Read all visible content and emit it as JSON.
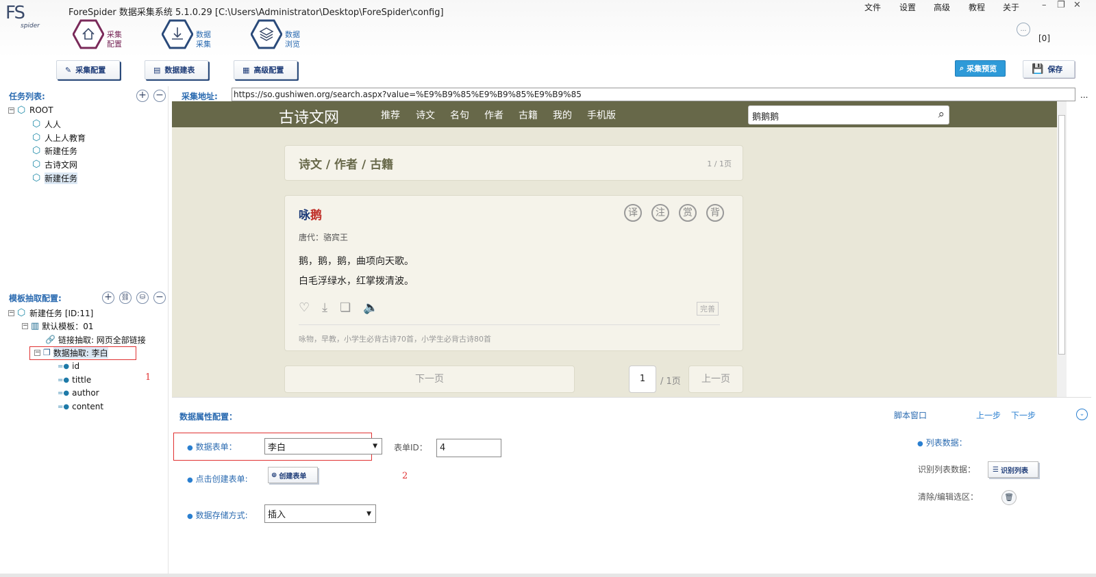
{
  "app": {
    "logo_text": "FS",
    "logo_sub": "spider",
    "window_title": "ForeSpider 数据采集系统  5.1.0.29  [C:\\Users\\Administrator\\Desktop\\ForeSpider\\config]",
    "counter": "[0]"
  },
  "menu": [
    "文件",
    "设置",
    "高级",
    "教程",
    "关于"
  ],
  "nav": [
    {
      "label1": "采集",
      "label2": "配置"
    },
    {
      "label1": "数据",
      "label2": "采集"
    },
    {
      "label1": "数据",
      "label2": "浏览"
    }
  ],
  "toolbar": {
    "collect_config": "采集配置",
    "data_table": "数据建表",
    "advanced_config": "高级配置",
    "preview": "采集预览",
    "save": "保存"
  },
  "task_list": {
    "title": "任务列表:",
    "root": "ROOT",
    "items": [
      "人人",
      "人上人教育",
      "新建任务",
      "古诗文网",
      "新建任务"
    ]
  },
  "url_bar": {
    "label": "采集地址:",
    "value": "https://so.gushiwen.org/search.aspx?value=%E9%B9%85%E9%B9%85%E9%B9%85",
    "more": "..."
  },
  "template": {
    "title": "模板抽取配置:",
    "task": "新建任务 [ID:11]",
    "default_template": "默认模板：01",
    "link_extract": "链接抽取: 网页全部链接",
    "data_extract": "数据抽取: 李白",
    "fields": [
      "id",
      "tittle",
      "author",
      "content"
    ],
    "annotation": "1"
  },
  "site": {
    "logo": "古诗文网",
    "nav": [
      "推荐",
      "诗文",
      "名句",
      "作者",
      "古籍",
      "我的",
      "手机版"
    ],
    "search_value": "鹅鹅鹅",
    "breadcrumb": "诗文 / 作者 / 古籍",
    "page_info": "1 / 1页",
    "poem_title_a": "咏",
    "poem_title_b": "鹅",
    "icons": [
      "译",
      "注",
      "赏",
      "背"
    ],
    "dynasty": "唐代：",
    "author": "骆宾王",
    "line1": "鹅，鹅，鹅，曲项向天歌。",
    "line2": "白毛浮绿水，红掌拨清波。",
    "perfect": "完善",
    "tags": "咏物，早教，小学生必背古诗70首，小学生必背古诗80首",
    "next": "下一页",
    "page_num": "1",
    "page_total": "/ 1页",
    "prev": "上一页"
  },
  "props": {
    "title": "数据属性配置：",
    "script_window": "脚本窗口",
    "prev_step": "上一步",
    "next_step": "下一步",
    "data_table_label": "数据表单：",
    "data_table_value": "李白",
    "table_id_label": "表单ID：",
    "table_id_value": "4",
    "create_label": "点击创建表单:",
    "create_btn": "创建表单",
    "annotation": "2",
    "storage_label": "数据存储方式:",
    "storage_value": "插入",
    "list_data": "列表数据：",
    "identify_list_label": "识别列表数据：",
    "identify_list_btn": "识别列表",
    "clear_label": "清除/编辑选区："
  }
}
